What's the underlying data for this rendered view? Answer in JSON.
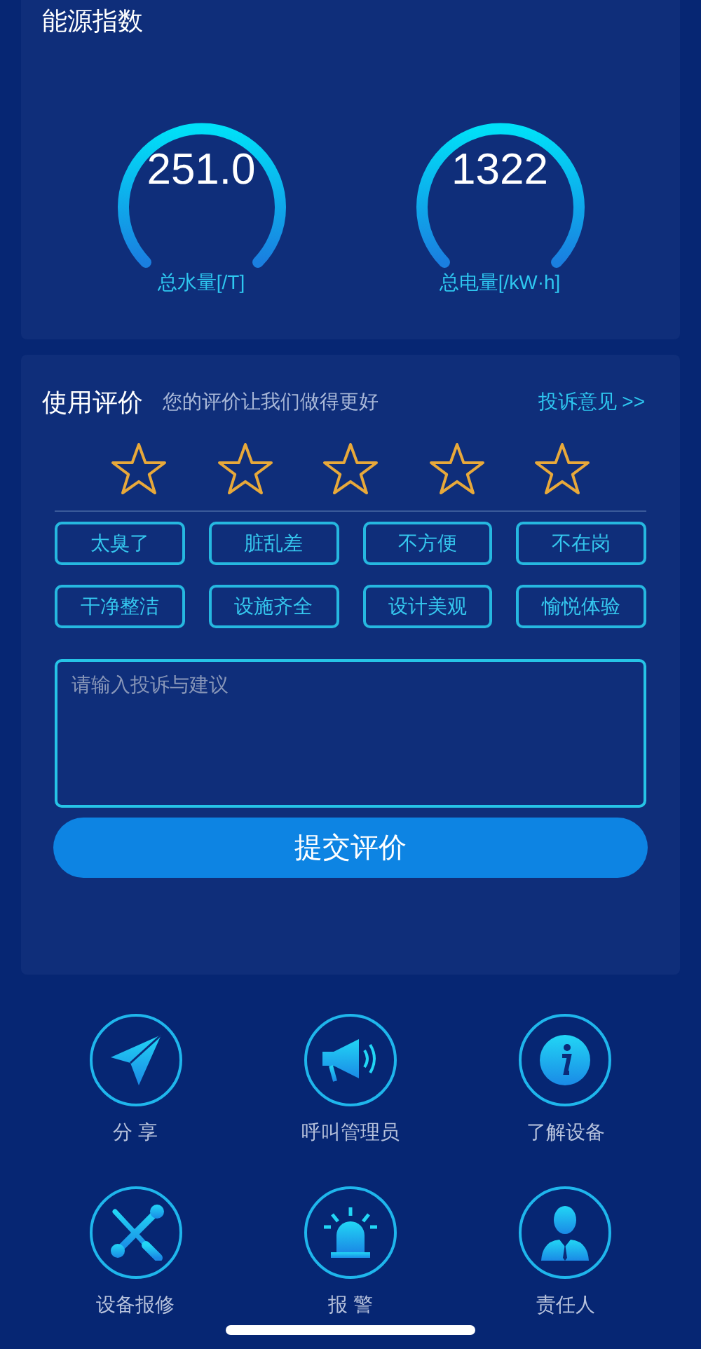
{
  "energy": {
    "title": "能源指数",
    "gauges": [
      {
        "value": "251.0",
        "label": "总水量[/T]"
      },
      {
        "value": "1322",
        "label": "总电量[/kW·h]"
      }
    ]
  },
  "rating": {
    "title": "使用评价",
    "subtitle": "您的评价让我们做得更好",
    "complaint_link": "投诉意见 >>",
    "stars": 0,
    "tags": [
      "太臭了",
      "脏乱差",
      "不方便",
      "不在岗",
      "干净整洁",
      "设施齐全",
      "设计美观",
      "愉悦体验"
    ],
    "input": {
      "placeholder": "请输入投诉与建议"
    },
    "submit": "提交评价"
  },
  "actions": [
    {
      "kind": "share",
      "label": "分 享"
    },
    {
      "kind": "call",
      "label": "呼叫管理员"
    },
    {
      "kind": "info",
      "label": "了解设备"
    },
    {
      "kind": "repair",
      "label": "设备报修"
    },
    {
      "kind": "alarm",
      "label": "报 警"
    },
    {
      "kind": "person",
      "label": "责任人"
    }
  ]
}
